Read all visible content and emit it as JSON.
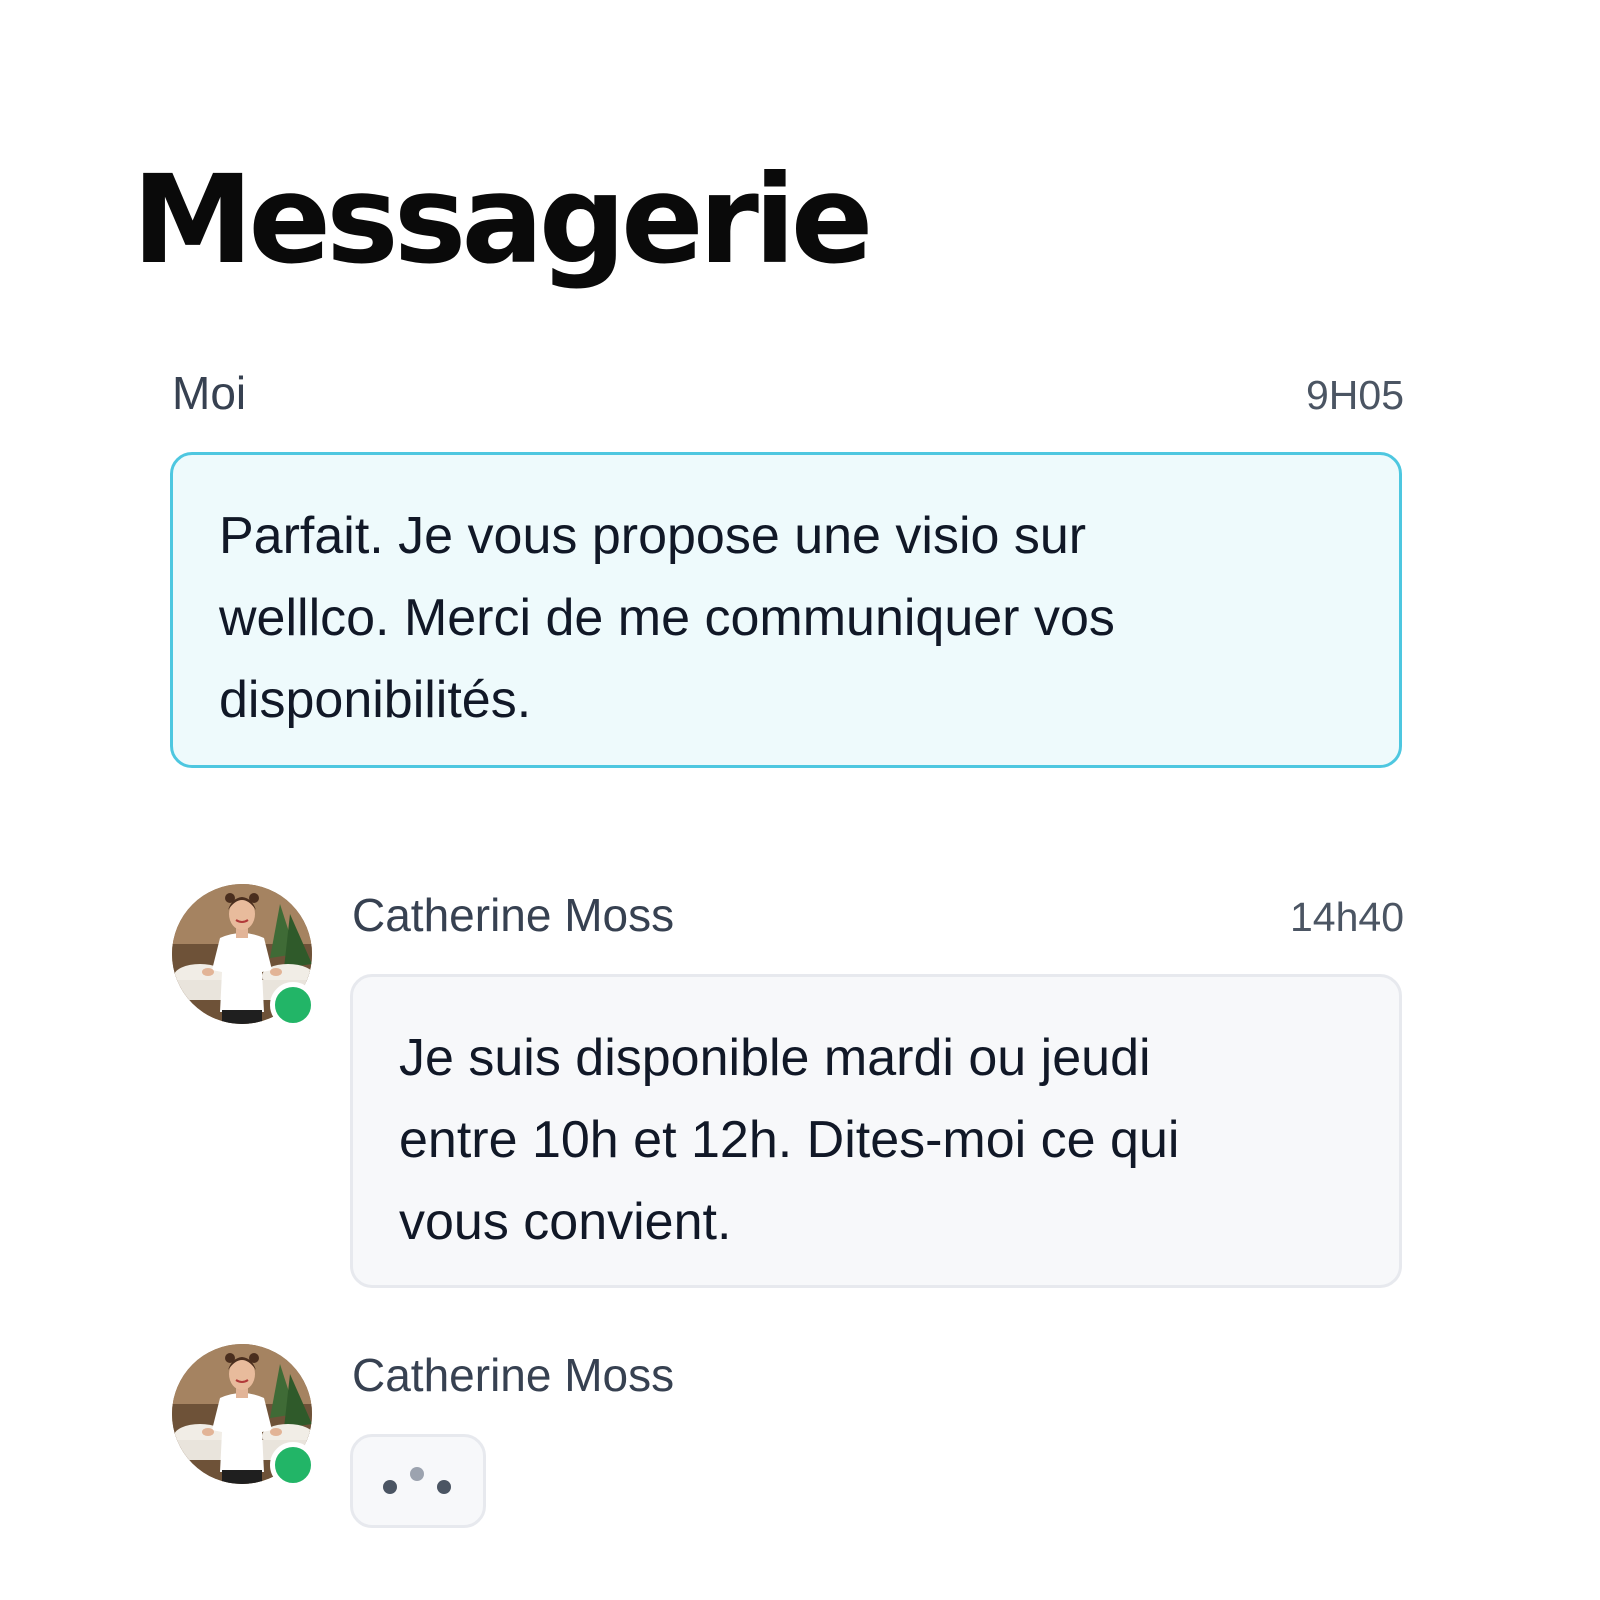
{
  "page": {
    "title": "Messagerie"
  },
  "messages": [
    {
      "sender": "Moi",
      "time": "9H05",
      "text": "Parfait. Je vous propose une visio sur\nwelllco. Merci de me communiquer vos\ndisponibilités."
    },
    {
      "sender": "Catherine Moss",
      "time": "14h40",
      "text": "Je suis disponible mardi ou jeudi\nentre 10h et 12h. Dites-moi ce qui\nvous convient.",
      "avatar_icon": "user-photo-avatar",
      "status": "online"
    }
  ],
  "typing": {
    "sender": "Catherine Moss",
    "avatar_icon": "user-photo-avatar",
    "status": "online",
    "indicator_icon": "typing-dots-icon"
  },
  "colors": {
    "my_bubble_bg": "#eefafc",
    "my_bubble_border": "#4ec7e0",
    "other_bubble_bg": "#f7f8fa",
    "other_bubble_border": "#e7e9ee",
    "online_status": "#22b567",
    "typing_dot_dark": "#4b5563",
    "typing_dot_light": "#9ca3af"
  }
}
